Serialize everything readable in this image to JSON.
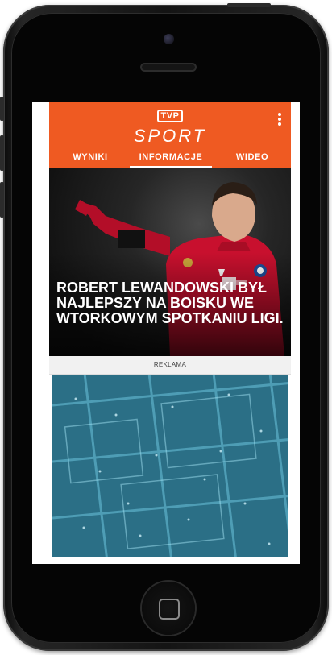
{
  "app": {
    "logo_box": "TVP",
    "logo_word": "SPORT"
  },
  "tabs": [
    {
      "label": "WYNIKI",
      "active": false
    },
    {
      "label": "INFORMACJE",
      "active": true
    },
    {
      "label": "WIDEO",
      "active": false
    }
  ],
  "article": {
    "headline": "ROBERT LEWANDOWSKI BYŁ NAJLEPSZY NA BOISKU WE WTORKOWYM SPOTKANIU LIGI."
  },
  "ad": {
    "label": "REKLAMA"
  },
  "colors": {
    "brand": "#ef5a22",
    "jersey": "#c8102e",
    "ad_background": "#2b6f86"
  },
  "icons": [
    "more-vertical-icon",
    "home-button-icon"
  ]
}
